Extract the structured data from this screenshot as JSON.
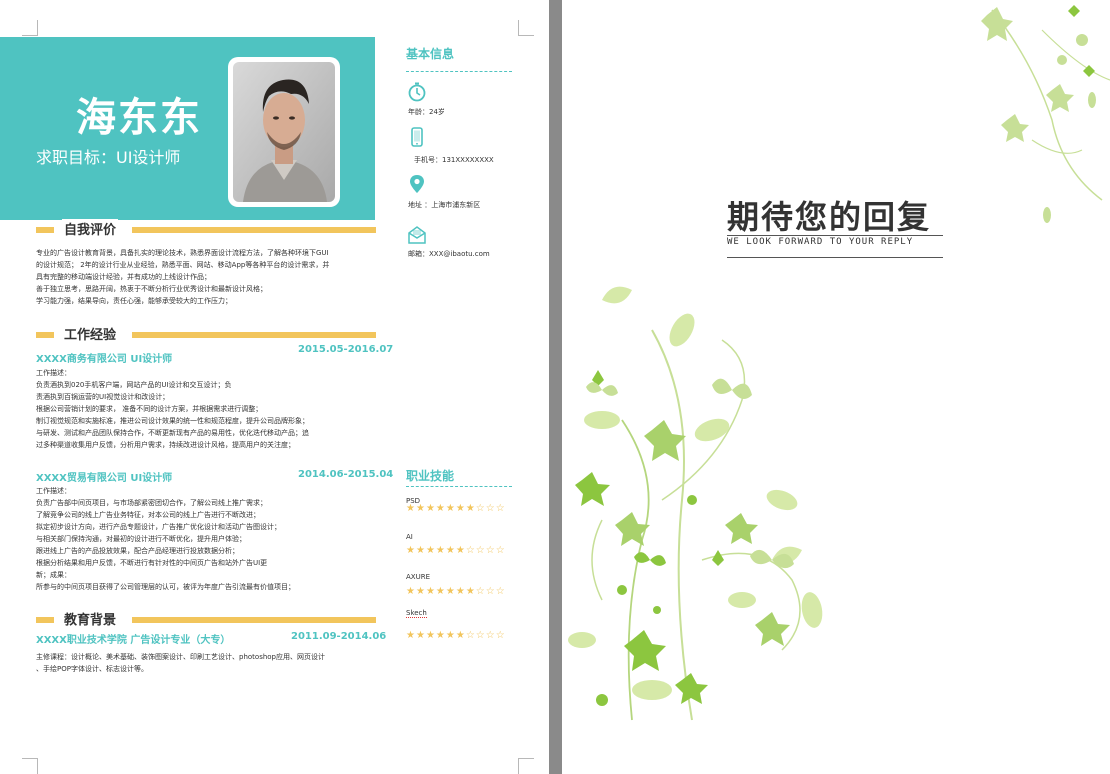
{
  "resume": {
    "name": "海东东",
    "target": "求职目标：UI设计师",
    "sections": {
      "self_eval": {
        "title": "自我评价",
        "lines": [
          "专业的广告设计教育背景，具备扎实的理论技术，熟悉界面设计流程方法，了解各种环境下GUI",
          "的设计规范； 2年的设计行业从业经验，熟悉平面、网站、移动App等各种平台的设计需求，并",
          "具有完整的移动端设计经验，并有成功的上线设计作品；",
          "善于独立思考，思路开阔，热衷于不断分析行业优秀设计和最新设计风格；",
          "学习能力强，结果导向，责任心强，能够承受较大的工作压力；"
        ]
      },
      "work": {
        "title": "工作经验",
        "jobs": [
          {
            "company": "XXXX商务有限公司  UI设计师",
            "date": "2015.05-2016.07",
            "lines": [
              "工作描述：",
              "负责酒执到020手机客户端，网站产品的UI设计和交互设计；负",
              "责酒执到百锅运营的UI视觉设计和改设计；",
              "根据公司营销计划的要求， 准备不同的设计方案，并根据需求进行调整；",
              "制订视觉规范和实施标准，推进公司设计效果的统一性和规范程度，提升公司品牌形象；",
              "与研发、测试和产品团队保持合作，不断更新现有产品的易用性，优化迭代移动产品；追",
              "过多种渠道收集用户反馈，分析用户需求，持续改进设计风格，提高用户的关注度；"
            ]
          },
          {
            "company": "XXXX贸易有限公司  UI设计师",
            "date": "2014.06-2015.04",
            "lines": [
              "工作描述：",
              "负责广告部中间页项目，与市场部紧密团切合作，了解公司线上推广需求；",
              "了解竞争公司的线上广告业务特征，对本公司的线上广告进行不断改进；",
              "拟定初步设计方向，进行产品专题设计，广告推广优化设计和活动广告图设计；",
              "与相关部门保持沟通，对最初的设计进行不断优化，提升用户体验；",
              "跟进线上广告的产品投放效果，配合产品经理进行投放数据分析；",
              "根据分析结果和用户反馈，不断进行有针对性的中间页广告和站外广告UI更",
              "新；成果：",
              "所参与的中间页项目获得了公司管理层的认可，被评为年度广告引流最有价值项目；"
            ]
          }
        ]
      },
      "education": {
        "title": "教育背景",
        "school": "XXXX职业技术学院  广告设计专业（大专）",
        "date": "2011.09-2014.06",
        "lines": [
          "主修课程：设计概论、美术基础、装饰图案设计、印刷工艺设计、photoshop应用、网页设计",
          "、手绘POP字体设计、标志设计等。"
        ]
      }
    },
    "basic_info": {
      "title": "基本信息",
      "age": "年龄：24岁",
      "phone": "手机号：131XXXXXXXX",
      "address": "地址 ：上海市浦东新区",
      "email": "邮箱：XXX@ibaotu.com"
    },
    "skills": {
      "title": "职业技能",
      "items": [
        {
          "label": "PSD",
          "stars": 7,
          "total": 10
        },
        {
          "label": "AI",
          "stars": 6,
          "total": 10
        },
        {
          "label": "AXURE",
          "stars": 7,
          "total": 10
        },
        {
          "label": "Skech",
          "stars": 6,
          "total": 10
        }
      ]
    }
  },
  "closing": {
    "title": "期待您的回复",
    "subtitle": "WE LOOK FORWARD TO YOUR  REPLY"
  },
  "colors": {
    "teal": "#4fc3c1",
    "yellow": "#f2c55c",
    "leaf_green": "#8cc63f",
    "leaf_light": "#d6e9a8"
  }
}
